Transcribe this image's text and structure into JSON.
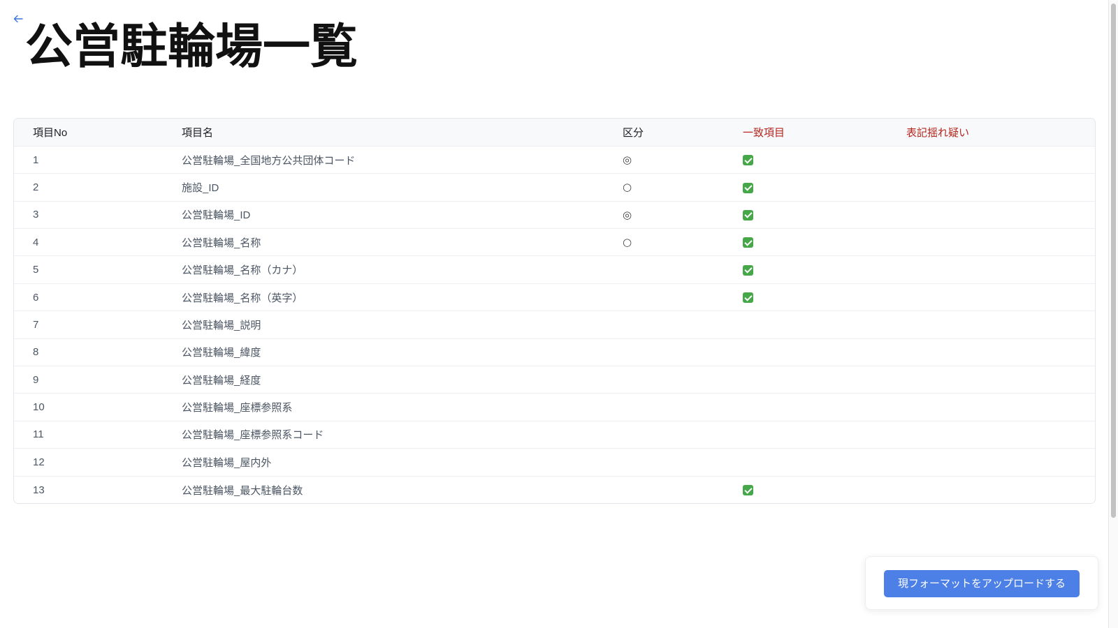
{
  "page": {
    "title": "公営駐輪場一覧",
    "back_icon": "arrow-left-icon"
  },
  "table": {
    "columns": [
      "項目No",
      "項目名",
      "区分",
      "一致項目",
      "表記揺れ疑い"
    ],
    "match_icon": "check-mark-icon",
    "rows": [
      {
        "no": 1,
        "name": "公営駐輪場_全国地方公共団体コード",
        "category": "◎",
        "match": true
      },
      {
        "no": 2,
        "name": "施設_ID",
        "category": "○",
        "match": true
      },
      {
        "no": 3,
        "name": "公営駐輪場_ID",
        "category": "◎",
        "match": true
      },
      {
        "no": 4,
        "name": "公営駐輪場_名称",
        "category": "○",
        "match": true
      },
      {
        "no": 5,
        "name": "公営駐輪場_名称（カナ）",
        "category": "",
        "match": true
      },
      {
        "no": 6,
        "name": "公営駐輪場_名称（英字）",
        "category": "",
        "match": true
      },
      {
        "no": 7,
        "name": "公営駐輪場_説明",
        "category": "",
        "match": false
      },
      {
        "no": 8,
        "name": "公営駐輪場_緯度",
        "category": "",
        "match": false
      },
      {
        "no": 9,
        "name": "公営駐輪場_経度",
        "category": "",
        "match": false
      },
      {
        "no": 10,
        "name": "公営駐輪場_座標参照系",
        "category": "",
        "match": false
      },
      {
        "no": 11,
        "name": "公営駐輪場_座標参照系コード",
        "category": "",
        "match": false
      },
      {
        "no": 12,
        "name": "公営駐輪場_屋内外",
        "category": "",
        "match": false
      },
      {
        "no": 13,
        "name": "公営駐輪場_最大駐輪台数",
        "category": "",
        "match": true
      }
    ]
  },
  "upload": {
    "button_label": "現フォーマットをアップロードする"
  },
  "colors": {
    "accent": "#4d80e6",
    "back_arrow": "#3b73e0",
    "highlight_header": "#b4261e",
    "check": "#45a747"
  }
}
